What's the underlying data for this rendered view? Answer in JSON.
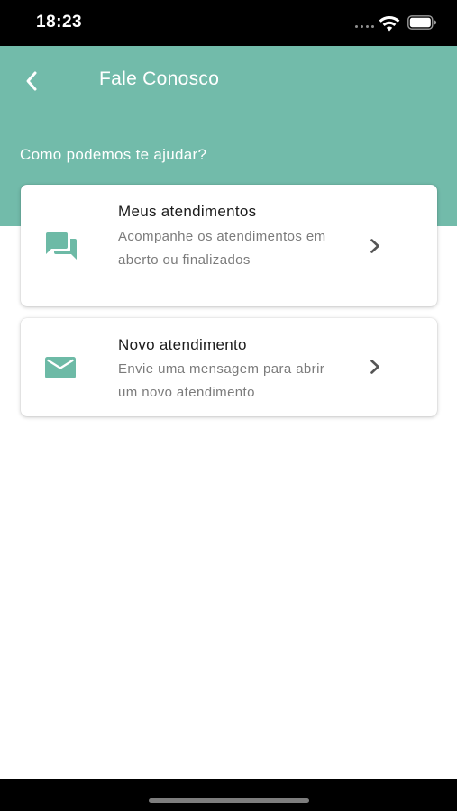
{
  "status_bar": {
    "time": "18:23",
    "icons": [
      "signal-dots-icon",
      "wifi-icon",
      "battery-icon"
    ]
  },
  "header": {
    "back_icon": "chevron-left-icon",
    "title": "Fale Conosco",
    "subtitle": "Como podemos te ajudar?"
  },
  "options": [
    {
      "icon": "chat-bubbles-icon",
      "title": "Meus atendimentos",
      "description": "Acompanhe os atendimentos em aberto ou finalizados",
      "chevron": "chevron-right-icon"
    },
    {
      "icon": "envelope-icon",
      "title": "Novo atendimento",
      "description": "Envie uma mensagem para abrir um novo atendimento",
      "chevron": "chevron-right-icon"
    }
  ],
  "colors": {
    "header_bg": "#72bbaa",
    "accent_icon": "#6dbaa6",
    "title_text": "#1b1b1b",
    "description_text": "#7b7b7b",
    "chevron": "#555555",
    "status_bar_bg": "#000000"
  }
}
